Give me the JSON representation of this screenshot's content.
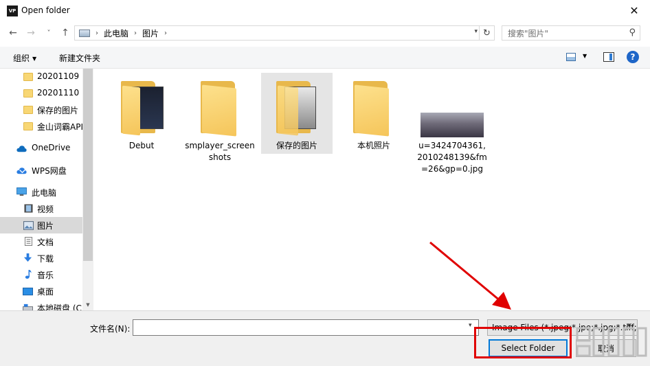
{
  "window": {
    "app_icon_text": "VP",
    "title": "Open folder",
    "close_glyph": "✕"
  },
  "nav": {
    "back_glyph": "←",
    "forward_glyph": "→",
    "recent_glyph": "˅",
    "up_glyph": "↑",
    "address_segments": [
      "此电脑",
      "图片"
    ],
    "address_sep": "›",
    "refresh_glyph": "↻",
    "search_placeholder": "搜索\"图片\""
  },
  "toolbar": {
    "organize_label": "组织",
    "new_folder_label": "新建文件夹",
    "help_label": "?"
  },
  "sidebar": {
    "items": [
      {
        "label": "20201109",
        "icon": "folder-icon",
        "selected": false
      },
      {
        "label": "20201110",
        "icon": "folder-icon",
        "selected": false
      },
      {
        "label": "保存的图片",
        "icon": "folder-icon",
        "selected": false
      },
      {
        "label": "金山词霸API",
        "icon": "folder-icon",
        "selected": false
      },
      {
        "label": "OneDrive",
        "icon": "cloud-icon",
        "selected": false
      },
      {
        "label": "WPS网盘",
        "icon": "wps-cloud-icon",
        "selected": false
      },
      {
        "label": "此电脑",
        "icon": "computer-icon",
        "selected": false
      },
      {
        "label": "视频",
        "icon": "video-icon",
        "selected": false
      },
      {
        "label": "图片",
        "icon": "pictures-icon",
        "selected": true
      },
      {
        "label": "文档",
        "icon": "documents-icon",
        "selected": false
      },
      {
        "label": "下载",
        "icon": "download-icon",
        "selected": false
      },
      {
        "label": "音乐",
        "icon": "music-icon",
        "selected": false
      },
      {
        "label": "桌面",
        "icon": "desktop-icon",
        "selected": false
      },
      {
        "label": "本地磁盘 (C",
        "icon": "disk-icon",
        "selected": false
      }
    ]
  },
  "files": [
    {
      "label": "Debut",
      "type": "folder"
    },
    {
      "label": "smplayer_screenshots",
      "type": "folder"
    },
    {
      "label": "保存的图片",
      "type": "folder"
    },
    {
      "label": "本机照片",
      "type": "folder"
    },
    {
      "label": "u=3424704361,2010248139&fm=26&gp=0.jpg",
      "type": "image"
    }
  ],
  "bottom": {
    "filename_label": "文件名(N):",
    "filename_value": "",
    "filter_value": "Image Files (*.jpeg;*.jpe;*.jpg;*.tiff;",
    "select_folder_label": "Select Folder",
    "cancel_label": "取消"
  },
  "colors": {
    "accent": "#0078d7",
    "annotation": "#e00000",
    "folder": "#f5c55a"
  }
}
